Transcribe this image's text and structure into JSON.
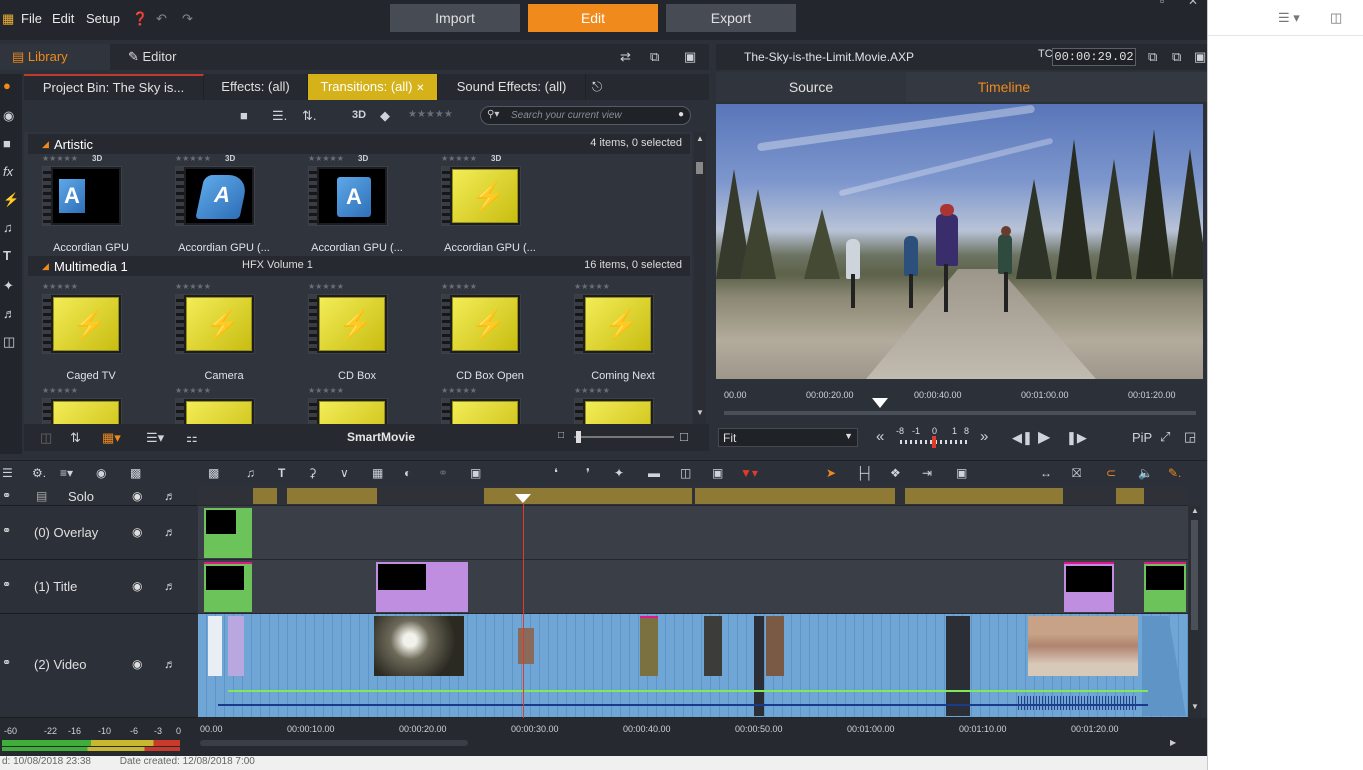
{
  "menubar": {
    "items": [
      "File",
      "Edit",
      "Setup"
    ],
    "modes": [
      "Import",
      "Edit",
      "Export"
    ],
    "active_mode": "Edit"
  },
  "library": {
    "library_tab": "Library",
    "editor_tab": "Editor",
    "tabs": [
      "Project Bin: The Sky is...",
      "Effects: (all)",
      "Transitions: (all)",
      "Sound Effects: (all)"
    ],
    "active_tab": "Transitions: (all)",
    "three_d": "3D",
    "search_placeholder": "Search your current view",
    "sections": [
      {
        "title": "Artistic",
        "count": "4 items, 0 selected",
        "items": [
          "Accordian GPU",
          "Accordian GPU (...",
          "Accordian GPU (...",
          "Accordian GPU (..."
        ]
      },
      {
        "title": "Multimedia 1",
        "meta": "HFX Volume 1",
        "count": "16 items, 0 selected",
        "items": [
          "Caged TV",
          "Camera",
          "CD Box",
          "CD Box Open",
          "Coming Next"
        ]
      }
    ],
    "smartmovie": "SmartMovie"
  },
  "preview": {
    "filename": "The-Sky-is-the-Limit.Movie.AXP",
    "tc_label": "TC",
    "timecode": "00:00:29.02",
    "tabs": [
      "Source",
      "Timeline"
    ],
    "active_tab": "Timeline",
    "ruler": [
      "00.00",
      "00:00:20.00",
      "00:00:40.00",
      "00:01:00.00",
      "00:01:20.00"
    ],
    "fit": "Fit",
    "shuttle": [
      "-8",
      "-1",
      "0",
      "1",
      "8"
    ],
    "pip": "PiP"
  },
  "timeline": {
    "tracks": [
      "Solo",
      "(0) Overlay",
      "(1) Title",
      "(2) Video"
    ],
    "ruler": [
      "00.00",
      "00:00:10.00",
      "00:00:20.00",
      "00:00:30.00",
      "00:00:40.00",
      "00:00:50.00",
      "00:01:00.00",
      "00:01:10.00",
      "00:01:20.00"
    ],
    "meter": [
      "-60",
      "-22",
      "-16",
      "-10",
      "-6",
      "-3",
      "0"
    ]
  },
  "status": {
    "modified": "d: 10/08/2018 23:38",
    "created": "Date created: 12/08/2018 7:00"
  },
  "colors": {
    "accent": "#f08a1c",
    "active_tab": "#d6b21a",
    "playhead": "#e23a2a",
    "clip_video": "#6fa6d6",
    "clip_title": "#c08ee0",
    "clip_overlay": "#6cc35a"
  }
}
